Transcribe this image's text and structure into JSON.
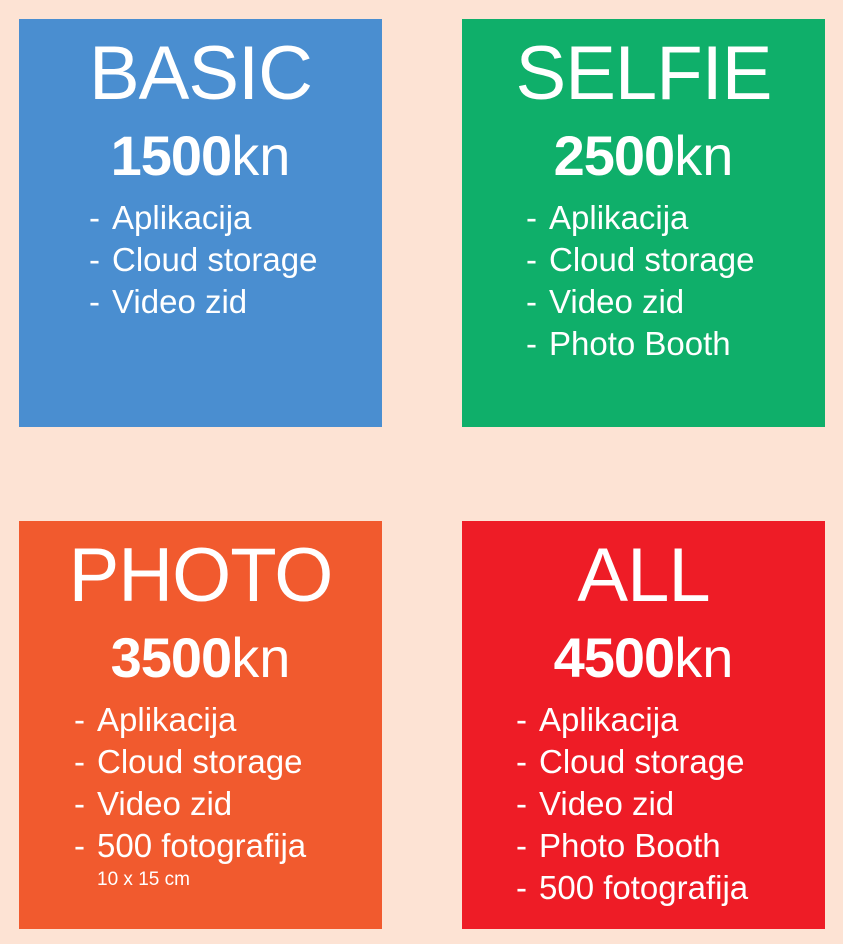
{
  "colors": {
    "background": "#FDE3D4",
    "basic": "#4A8ED0",
    "selfie": "#0FAF6A",
    "photo": "#F15A2E",
    "all": "#EE1C26",
    "text": "#FFFFFF"
  },
  "packages": [
    {
      "title": "BASIC",
      "price": "1500",
      "unit": "kn",
      "features": [
        "Aplikacija",
        "Cloud storage",
        "Video zid"
      ]
    },
    {
      "title": "SELFIE",
      "price": "2500",
      "unit": "kn",
      "features": [
        "Aplikacija",
        "Cloud storage",
        "Video zid",
        "Photo Booth"
      ]
    },
    {
      "title": "PHOTO",
      "price": "3500",
      "unit": "kn",
      "features": [
        "Aplikacija",
        "Cloud storage",
        "Video zid",
        "500 fotografija"
      ],
      "note": "10 x 15 cm"
    },
    {
      "title": "ALL",
      "price": "4500",
      "unit": "kn",
      "features": [
        "Aplikacija",
        "Cloud storage",
        "Video zid",
        "Photo Booth",
        "500 fotografija"
      ]
    }
  ],
  "bullet": "-"
}
